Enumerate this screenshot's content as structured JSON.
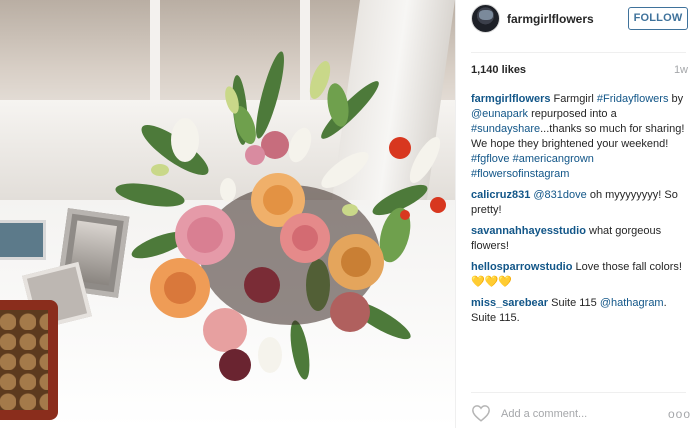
{
  "post": {
    "username": "farmgirlflowers",
    "follow_label": "FOLLOW",
    "likes": "1,140 likes",
    "age": "1w"
  },
  "caption": {
    "user": "farmgirlflowers",
    "part1": " Farmgirl ",
    "tag1": "#Fridayflowers",
    "part2": " by ",
    "mention": "@eunapark",
    "part3": " repurposed into a ",
    "tag2": "#sundayshare",
    "part4": "...thanks so much for sharing! We hope they brightened your weekend! ",
    "tag3": "#fgflove",
    "space": " ",
    "tag4": "#americangrown",
    "tag5": "#flowersofinstagram"
  },
  "comments": [
    {
      "user": "calicruz831",
      "mention": "@831dove",
      "text": " oh myyyyyyyy! So pretty!"
    },
    {
      "user": "savannahhayesstudio",
      "text": " what gorgeous flowers!"
    },
    {
      "user": "hellosparrowstudio",
      "text": " Love those fall colors!",
      "emoji": "💛💛💛"
    },
    {
      "user": "miss_sarebear",
      "text": " Suite 115 ",
      "mention": "@hathagram",
      "tail": ". Suite 115."
    }
  ],
  "footer": {
    "placeholder": "Add a comment...",
    "more": "ooo"
  },
  "icons": {
    "heart": "heart-outline-icon",
    "more": "ellipsis-icon"
  },
  "colors": {
    "link": "#125688",
    "follow": "#3f729b",
    "muted": "#a5a7aa"
  }
}
